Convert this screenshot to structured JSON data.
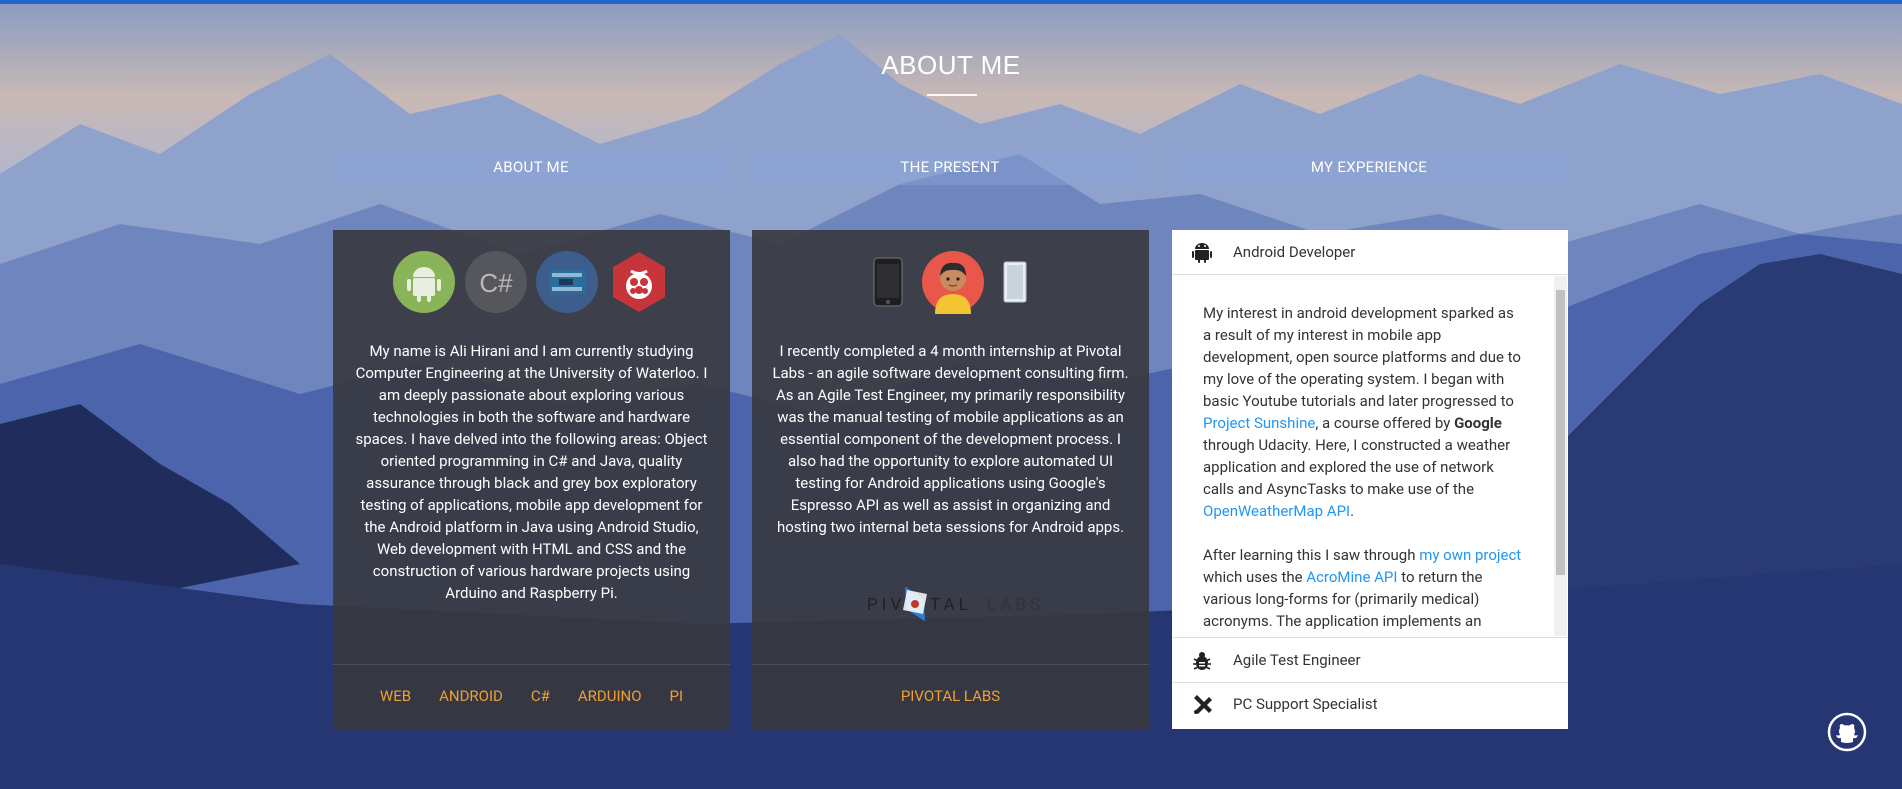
{
  "page": {
    "title": "ABOUT ME"
  },
  "tabs": [
    "ABOUT ME",
    "THE PRESENT",
    "MY EXPERIENCE"
  ],
  "about_card": {
    "text": "My name is Ali Hirani and I am currently studying Computer Engineering at the University of Waterloo. I am deeply passionate about exploring various technologies in both the software and hardware spaces. I have delved into the following areas: Object oriented programming in C# and Java, quality assurance through black and grey box exploratory testing of applications, mobile app development for the Android platform in Java using Android Studio, Web development with HTML and CSS and the construction of various hardware projects using Arduino and Raspberry Pi.",
    "icons": [
      "android-icon",
      "csharp-icon",
      "arduino-icon",
      "raspberry-pi-icon"
    ],
    "links": [
      "WEB",
      "ANDROID",
      "C#",
      "ARDUINO",
      "PI"
    ]
  },
  "present_card": {
    "text": "I recently completed a 4 month internship at Pivotal Labs - an agile software development consulting firm. As an Agile Test Engineer, my primarily responsibility was the manual testing of mobile applications as an essential component of the development process. I also had the opportunity to explore automated UI testing for Android applications using Google's Espresso API as well as assist in organizing and hosting two internal beta sessions for Android apps.",
    "icons": [
      "phone-icon",
      "avatar",
      "tablet-icon"
    ],
    "logo_text_left": "PIV",
    "logo_text_mid": "TAL",
    "logo_text_right": "LABS",
    "links": [
      "PIVOTAL LABS"
    ]
  },
  "experience": {
    "items": [
      {
        "label": "Android Developer",
        "icon": "android-icon"
      },
      {
        "label": "Agile Test Engineer",
        "icon": "bug-icon"
      },
      {
        "label": "PC Support Specialist",
        "icon": "tools-icon"
      }
    ],
    "body": {
      "p1_a": "My interest in android development sparked as a result of my interest in mobile app development, open source platforms and due to my love of the operating system. I began with basic Youtube tutorials and later progressed to ",
      "p1_link1": "Project Sunshine",
      "p1_b": ", a course offered by ",
      "p1_bold": "Google",
      "p1_c": " through Udacity. Here, I constructed a weather application and explored the use of network calls and AsyncTasks to make use of the ",
      "p1_link2": "OpenWeatherMap API",
      "p1_d": ".",
      "p2_a": "After learning this I saw through ",
      "p2_link1": "my own project",
      "p2_b": " which uses the ",
      "p2_link2": "AcroMine API",
      "p2_c": " to return the various long-forms for (primarily medical) acronyms. The application implements an"
    }
  },
  "colors": {
    "accent_link": "#f0a033",
    "body_link": "#2196f3",
    "top_bar": "#1e66c8"
  }
}
